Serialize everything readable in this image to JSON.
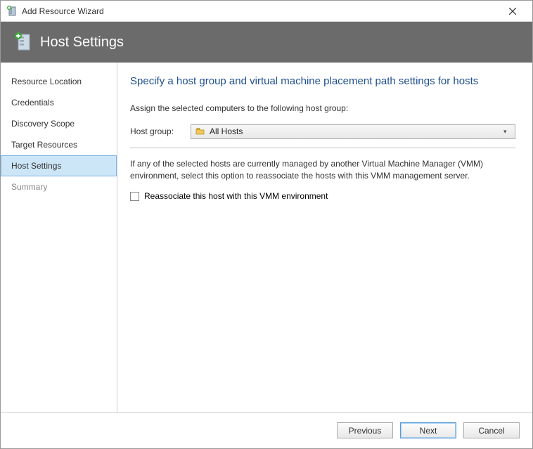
{
  "window": {
    "title": "Add Resource Wizard"
  },
  "banner": {
    "title": "Host Settings"
  },
  "sidebar": {
    "items": [
      {
        "label": "Resource Location",
        "selected": false,
        "dim": false
      },
      {
        "label": "Credentials",
        "selected": false,
        "dim": false
      },
      {
        "label": "Discovery Scope",
        "selected": false,
        "dim": false
      },
      {
        "label": "Target Resources",
        "selected": false,
        "dim": false
      },
      {
        "label": "Host Settings",
        "selected": true,
        "dim": false
      },
      {
        "label": "Summary",
        "selected": false,
        "dim": true
      }
    ]
  },
  "content": {
    "heading": "Specify a host group and virtual machine placement path settings for hosts",
    "assign_text": "Assign the selected computers to the following host group:",
    "host_group_label": "Host group:",
    "host_group_value": "All Hosts",
    "reassociate_intro": "If any of the selected hosts are currently managed by another Virtual Machine Manager (VMM) environment, select this option to reassociate the hosts with this VMM management server.",
    "reassociate_checkbox_label": "Reassociate this host with this VMM environment",
    "reassociate_checked": false
  },
  "footer": {
    "previous": "Previous",
    "next": "Next",
    "cancel": "Cancel"
  }
}
